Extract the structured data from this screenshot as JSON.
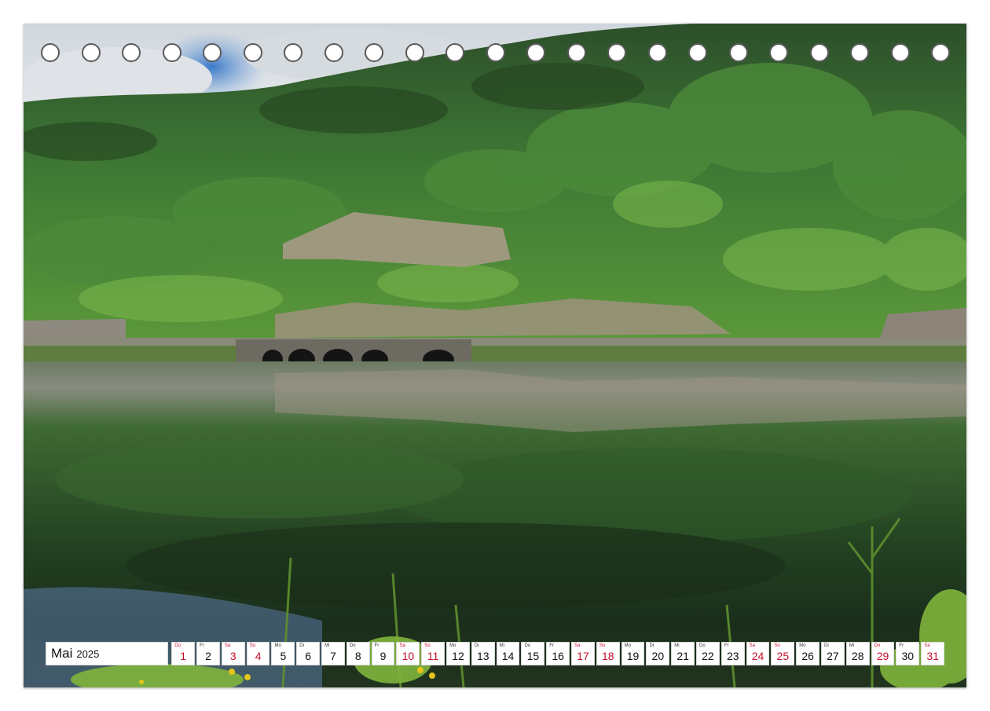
{
  "calendar": {
    "month": "Mai",
    "year": "2025",
    "days": [
      {
        "wd": "Do",
        "num": "1",
        "red": true
      },
      {
        "wd": "Fr",
        "num": "2",
        "red": false
      },
      {
        "wd": "Sa",
        "num": "3",
        "red": true
      },
      {
        "wd": "So",
        "num": "4",
        "red": true
      },
      {
        "wd": "Mo",
        "num": "5",
        "red": false
      },
      {
        "wd": "Di",
        "num": "6",
        "red": false
      },
      {
        "wd": "Mi",
        "num": "7",
        "red": false
      },
      {
        "wd": "Do",
        "num": "8",
        "red": false
      },
      {
        "wd": "Fr",
        "num": "9",
        "red": false
      },
      {
        "wd": "Sa",
        "num": "10",
        "red": true
      },
      {
        "wd": "So",
        "num": "11",
        "red": true
      },
      {
        "wd": "Mo",
        "num": "12",
        "red": false
      },
      {
        "wd": "Di",
        "num": "13",
        "red": false
      },
      {
        "wd": "Mi",
        "num": "14",
        "red": false
      },
      {
        "wd": "Do",
        "num": "15",
        "red": false
      },
      {
        "wd": "Fr",
        "num": "16",
        "red": false
      },
      {
        "wd": "Sa",
        "num": "17",
        "red": true
      },
      {
        "wd": "So",
        "num": "18",
        "red": true
      },
      {
        "wd": "Mo",
        "num": "19",
        "red": false
      },
      {
        "wd": "Di",
        "num": "20",
        "red": false
      },
      {
        "wd": "Mi",
        "num": "21",
        "red": false
      },
      {
        "wd": "Do",
        "num": "22",
        "red": false
      },
      {
        "wd": "Fr",
        "num": "23",
        "red": false
      },
      {
        "wd": "Sa",
        "num": "24",
        "red": true
      },
      {
        "wd": "So",
        "num": "25",
        "red": true
      },
      {
        "wd": "Mo",
        "num": "26",
        "red": false
      },
      {
        "wd": "Di",
        "num": "27",
        "red": false
      },
      {
        "wd": "Mi",
        "num": "28",
        "red": false
      },
      {
        "wd": "Do",
        "num": "29",
        "red": true
      },
      {
        "wd": "Fr",
        "num": "30",
        "red": false
      },
      {
        "wd": "Sa",
        "num": "31",
        "red": true
      }
    ]
  },
  "colors": {
    "holiday_red": "#c8102e",
    "forest_dark": "#2f5a2c",
    "forest_light": "#6fa83f",
    "water_dark": "#1d3320",
    "sky_blue": "#3e7cc7"
  }
}
